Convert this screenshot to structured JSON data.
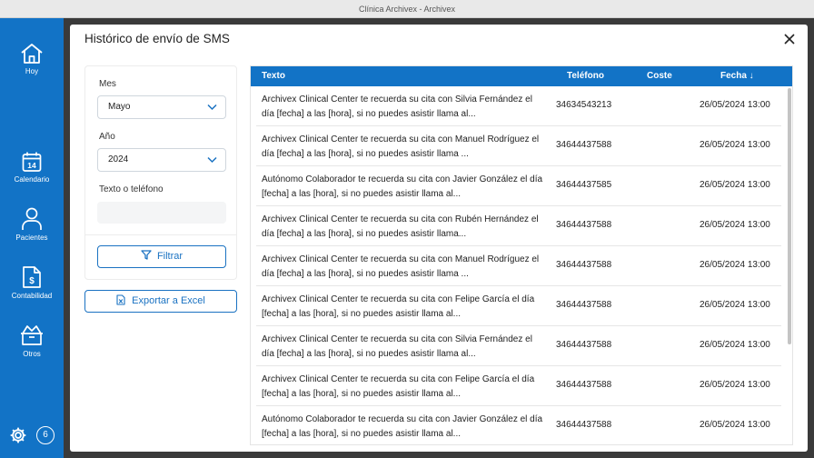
{
  "window": {
    "title": "Clínica Archivex - Archivex"
  },
  "sidebar": {
    "items": [
      {
        "label": "Hoy",
        "icon": "home-icon"
      },
      {
        "label": "Calendario",
        "icon": "calendar-icon",
        "day": "14"
      },
      {
        "label": "Pacientes",
        "icon": "user-icon"
      },
      {
        "label": "Contabilidad",
        "icon": "invoice-icon"
      },
      {
        "label": "Otros",
        "icon": "box-icon"
      }
    ],
    "settings_icon": "gear-icon",
    "badge": "6"
  },
  "modal": {
    "title": "Histórico de envío de SMS",
    "close_icon": "close-icon"
  },
  "filters": {
    "month_label": "Mes",
    "month_value": "Mayo",
    "year_label": "Año",
    "year_value": "2024",
    "search_label": "Texto o teléfono",
    "search_value": "",
    "filter_button": "Filtrar",
    "export_button": "Exportar a Excel"
  },
  "table": {
    "columns": {
      "text": "Texto",
      "phone": "Teléfono",
      "cost": "Coste",
      "date": "Fecha ↓"
    },
    "rows": [
      {
        "text": "Archivex Clinical Center te recuerda su cita con Silvia Fernández el día [fecha] a las [hora], si no puedes asistir llama al...",
        "phone": "34634543213",
        "cost": "",
        "date": "26/05/2024 13:00"
      },
      {
        "text": "Archivex Clinical Center te recuerda su cita con Manuel Rodríguez el día [fecha] a las [hora], si no puedes asistir llama ...",
        "phone": "34644437588",
        "cost": "",
        "date": "26/05/2024 13:00"
      },
      {
        "text": "Autónomo Colaborador te recuerda su cita con Javier González el día [fecha] a las [hora], si no puedes asistir llama al...",
        "phone": "34644437585",
        "cost": "",
        "date": "26/05/2024 13:00"
      },
      {
        "text": "Archivex Clinical Center te recuerda su cita con Rubén Hernández el día [fecha] a las [hora], si no puedes asistir llama...",
        "phone": "34644437588",
        "cost": "",
        "date": "26/05/2024 13:00"
      },
      {
        "text": "Archivex Clinical Center te recuerda su cita con Manuel Rodríguez el día [fecha] a las [hora], si no puedes asistir llama ...",
        "phone": "34644437588",
        "cost": "",
        "date": "26/05/2024 13:00"
      },
      {
        "text": "Archivex Clinical Center te recuerda su cita con Felipe García el día [fecha] a las [hora], si no puedes asistir llama al...",
        "phone": "34644437588",
        "cost": "",
        "date": "26/05/2024 13:00"
      },
      {
        "text": "Archivex Clinical Center te recuerda su cita con Silvia Fernández el día [fecha] a las [hora], si no puedes asistir llama al...",
        "phone": "34644437588",
        "cost": "",
        "date": "26/05/2024 13:00"
      },
      {
        "text": "Archivex Clinical Center te recuerda su cita con Felipe García el día [fecha] a las [hora], si no puedes asistir llama al...",
        "phone": "34644437588",
        "cost": "",
        "date": "26/05/2024 13:00"
      },
      {
        "text": "Autónomo Colaborador te recuerda su cita con Javier González el día [fecha] a las [hora], si no puedes asistir llama al...",
        "phone": "34644437588",
        "cost": "",
        "date": "26/05/2024 13:00"
      }
    ]
  },
  "colors": {
    "accent": "#1273c6",
    "button_border": "#1a72c2"
  }
}
